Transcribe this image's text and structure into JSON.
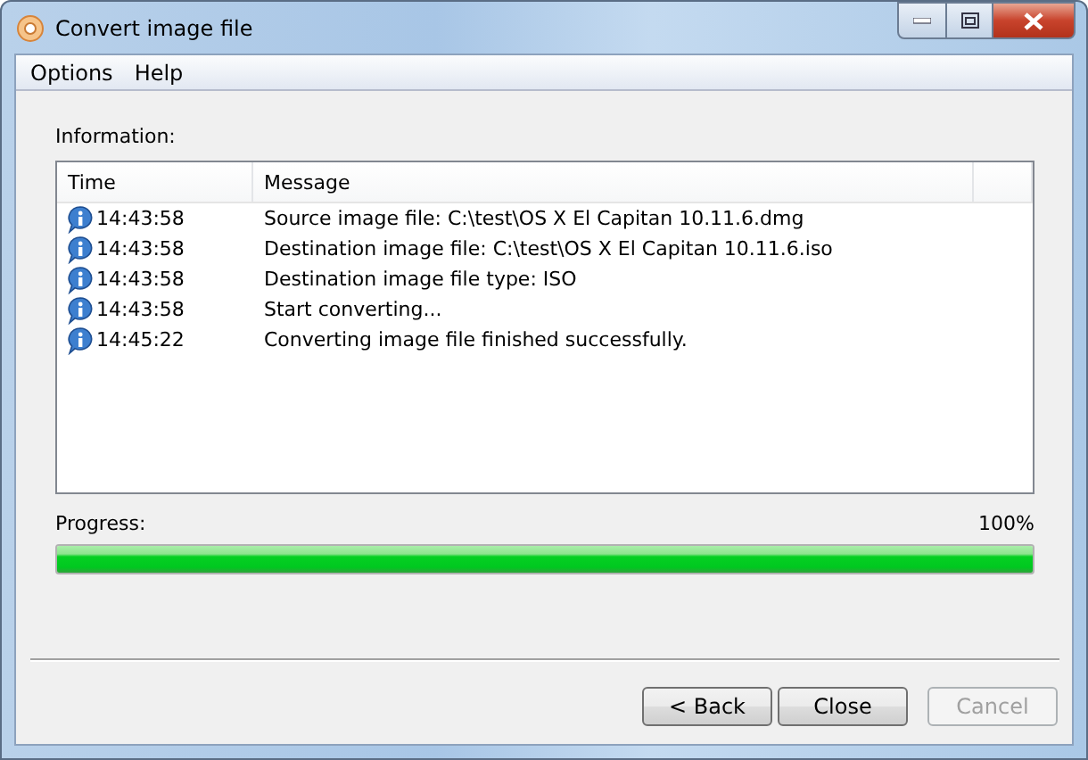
{
  "window": {
    "title": "Convert image file"
  },
  "menu": [
    "Options",
    "Help"
  ],
  "information_label": "Information:",
  "log": {
    "columns": [
      "Time",
      "Message"
    ],
    "rows": [
      {
        "time": "14:43:58",
        "message": "Source image file:  C:\\test\\OS X El Capitan 10.11.6.dmg"
      },
      {
        "time": "14:43:58",
        "message": "Destination image file:  C:\\test\\OS X El Capitan 10.11.6.iso"
      },
      {
        "time": "14:43:58",
        "message": "Destination image file type:  ISO"
      },
      {
        "time": "14:43:58",
        "message": "Start converting..."
      },
      {
        "time": "14:45:22",
        "message": "Converting image file finished successfully."
      }
    ]
  },
  "progress": {
    "label": "Progress:",
    "reading": "100%",
    "level": 1
  },
  "buttons": [
    {
      "label": "< Back",
      "disabled": false
    },
    {
      "label": "Close",
      "disabled": false
    },
    {
      "label": "Cancel",
      "disabled": true
    }
  ]
}
